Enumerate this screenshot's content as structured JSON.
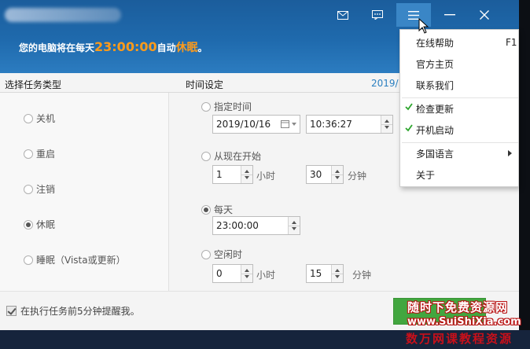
{
  "window": {
    "title_blurred": "",
    "status_prefix": "您的电脑将在每天",
    "status_time": "23:00:00",
    "status_middle": "自动",
    "status_action": "休眠",
    "status_suffix": "。"
  },
  "titlebar": {
    "buttons": [
      {
        "name": "mail",
        "icon": "mail-icon"
      },
      {
        "name": "feedback",
        "icon": "chat-icon"
      },
      {
        "name": "menu",
        "icon": "hamburger-icon",
        "active": true
      },
      {
        "name": "minimize",
        "icon": "minimize-icon"
      },
      {
        "name": "close",
        "icon": "close-icon"
      }
    ]
  },
  "task_types": {
    "header": "选择任务类型",
    "options": [
      {
        "label": "关机",
        "checked": false
      },
      {
        "label": "重启",
        "checked": false
      },
      {
        "label": "注销",
        "checked": false
      },
      {
        "label": "休眠",
        "checked": true
      },
      {
        "label": "睡眠（Vista或更新）",
        "checked": false
      }
    ]
  },
  "time_settings": {
    "header": "时间设定",
    "date_display": "2019/1",
    "specific": {
      "label": "指定时间",
      "date": "2019/10/16",
      "time": "10:36:27"
    },
    "from_now": {
      "label": "从现在开始",
      "hours": "1",
      "hours_unit": "小时",
      "minutes": "30",
      "minutes_unit": "分钟"
    },
    "daily": {
      "label": "每天",
      "time": "23:00:00",
      "checked": true
    },
    "idle": {
      "label": "空闲时",
      "hours": "0",
      "hours_unit": "小时",
      "minutes": "15",
      "minutes_unit": "分钟"
    }
  },
  "footer": {
    "remind_label": "在执行任务前5分钟提醒我。",
    "remind_checked": true
  },
  "menu": {
    "items": [
      {
        "label": "在线帮助",
        "shortcut": "F1"
      },
      {
        "label": "官方主页"
      },
      {
        "label": "联系我们"
      },
      {
        "label": "检查更新",
        "checked": true
      },
      {
        "label": "开机启动",
        "checked": true
      },
      {
        "label": "多国语言",
        "submenu": true
      },
      {
        "label": "关于"
      }
    ]
  },
  "watermark": {
    "line1": "随时下免费资源网",
    "line2": "www.SuiShiXia.com",
    "line3": "数万网课教程资源"
  },
  "colors": {
    "header_blue": "#1f6aad",
    "accent_orange": "#ff9b1a",
    "link_blue": "#2a7fc0",
    "check_green": "#2da52d"
  }
}
